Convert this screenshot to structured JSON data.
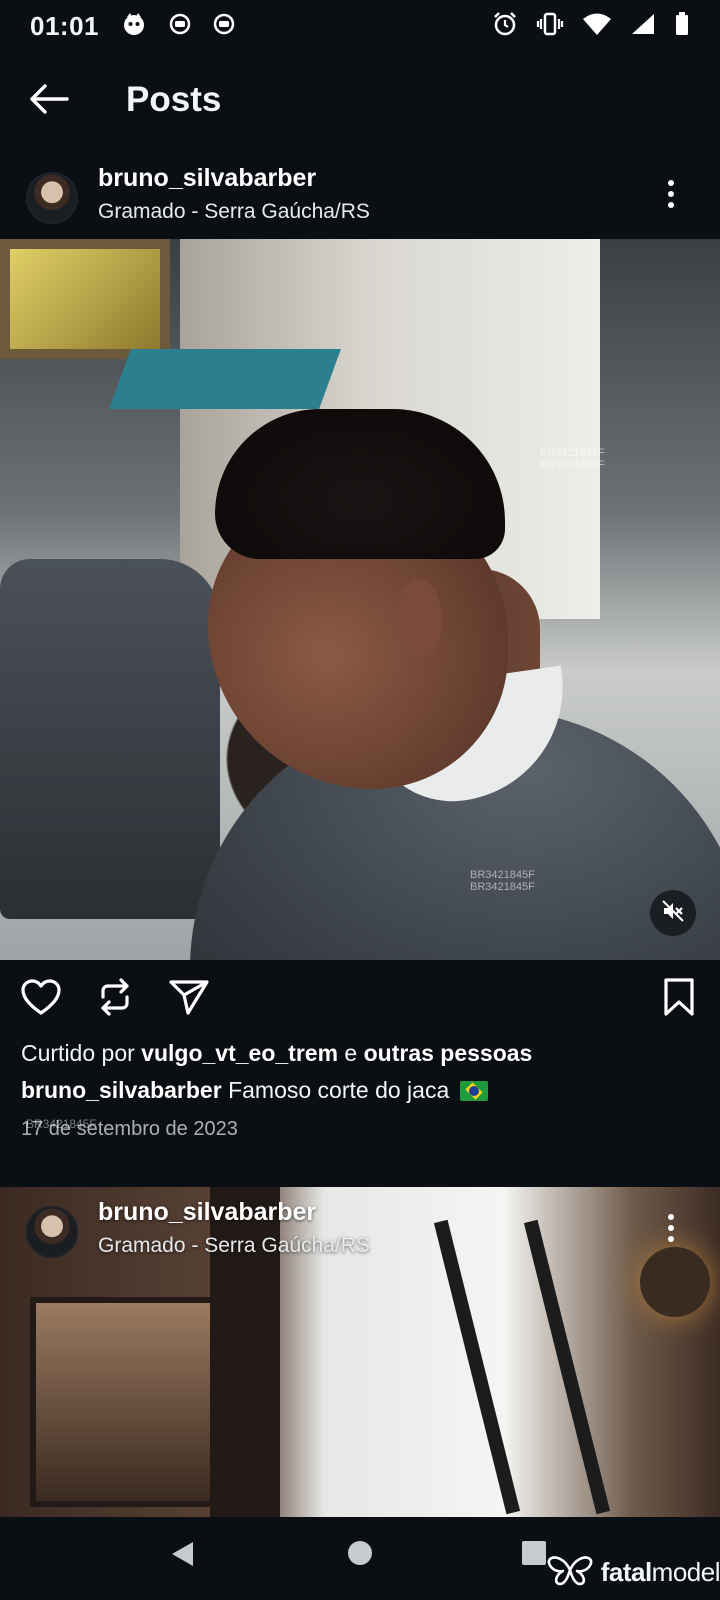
{
  "status_bar": {
    "time": "01:01",
    "icons_left": [
      "notification-app-icon",
      "media-icon",
      "media-icon"
    ],
    "icons_right": [
      "alarm-icon",
      "vibrate-icon",
      "wifi-icon",
      "signal-icon",
      "battery-icon"
    ]
  },
  "header": {
    "title": "Posts",
    "back_icon": "arrow-left-icon"
  },
  "posts": [
    {
      "username": "bruno_silvabarber",
      "location": "Gramado - Serra Gaúcha/RS",
      "watermark_text": "BR3421845F",
      "liked_prefix": "Curtido por",
      "liked_user": "vulgo_vt_eo_trem",
      "liked_connector": "e",
      "liked_suffix": "outras pessoas",
      "caption_user": "bruno_silvabarber",
      "caption_text": "Famoso corte do jaca",
      "date": "17 de setembro de 2023",
      "muted": true
    },
    {
      "username": "bruno_silvabarber",
      "location": "Gramado - Serra Gaúcha/RS"
    }
  ],
  "nav": {
    "back": "back-triangle-icon",
    "home": "home-circle-icon",
    "recents": "recents-square-icon"
  },
  "brand": {
    "name_bold": "fatal",
    "name_regular": "model"
  },
  "colors": {
    "background": "#0b0f14",
    "text": "#f3f5f7",
    "muted_text": "#aab0b6"
  }
}
